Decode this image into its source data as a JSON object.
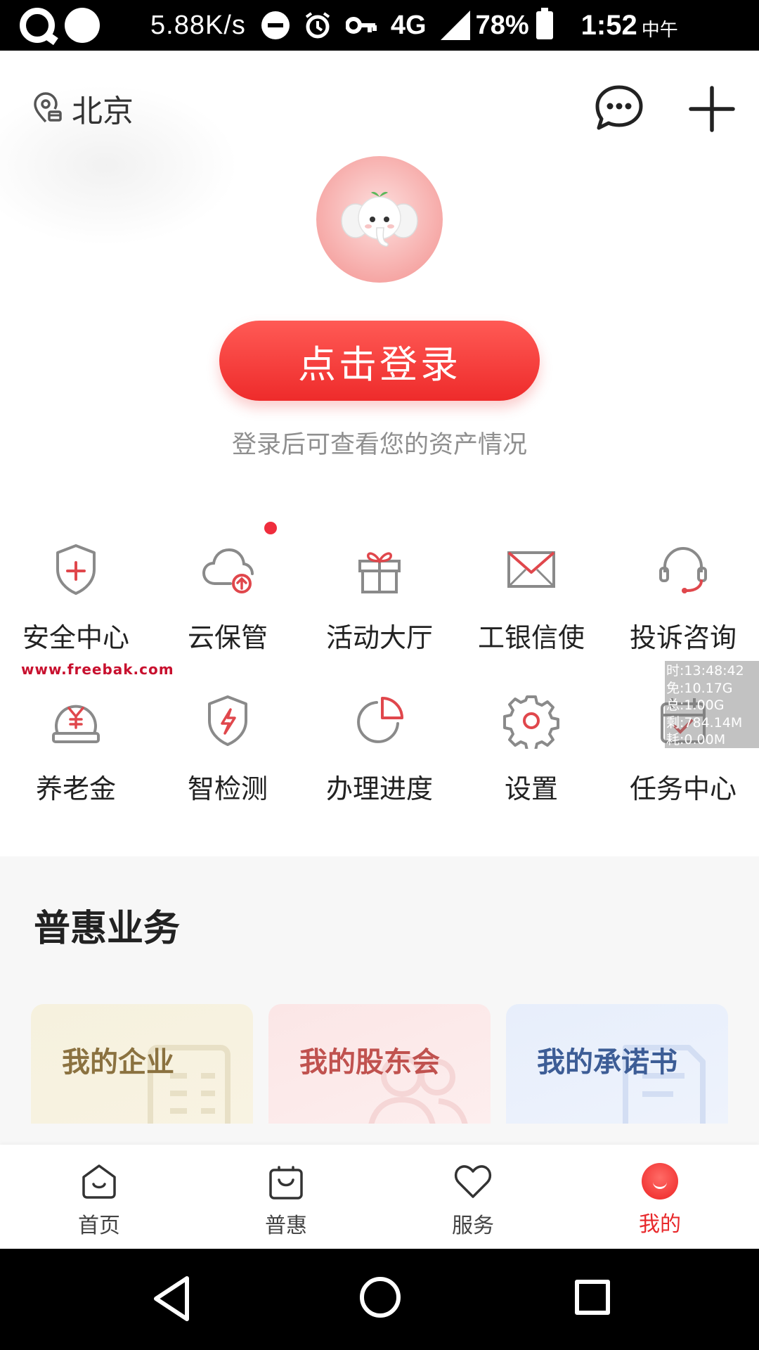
{
  "status_bar": {
    "speed": "5.88K/s",
    "network": "4G",
    "battery": "78%",
    "time": "1:52",
    "ampm": "中午"
  },
  "header": {
    "location": "北京"
  },
  "login": {
    "button": "点击登录",
    "hint": "登录后可查看您的资产情况"
  },
  "grid": {
    "items": [
      {
        "label": "安全中心",
        "icon": "shield-plus-icon"
      },
      {
        "label": "云保管",
        "icon": "cloud-upload-icon"
      },
      {
        "label": "活动大厅",
        "icon": "gift-icon"
      },
      {
        "label": "工银信使",
        "icon": "envelope-icon"
      },
      {
        "label": "投诉咨询",
        "icon": "headset-icon"
      },
      {
        "label": "养老金",
        "icon": "yuan-coin-icon"
      },
      {
        "label": "智检测",
        "icon": "shield-lightning-icon"
      },
      {
        "label": "办理进度",
        "icon": "pie-progress-icon"
      },
      {
        "label": "设置",
        "icon": "gear-icon"
      },
      {
        "label": "任务中心",
        "icon": "calendar-task-icon"
      }
    ]
  },
  "watermark": "www.freebak.com",
  "overlay_stats": [
    "时:13:48:42",
    "免:10.17G",
    "总:1.00G",
    "剩:784.14M",
    "耗:0.00M"
  ],
  "section": {
    "title": "普惠业务",
    "cards": [
      {
        "label": "我的企业"
      },
      {
        "label": "我的股东会"
      },
      {
        "label": "我的承诺书"
      }
    ]
  },
  "tabs": [
    {
      "label": "首页",
      "icon": "home-icon"
    },
    {
      "label": "普惠",
      "icon": "bag-icon"
    },
    {
      "label": "服务",
      "icon": "heart-icon"
    },
    {
      "label": "我的",
      "icon": "me-icon",
      "active": true
    }
  ],
  "colors": {
    "accent": "#ee2b2b",
    "icon_red": "#e0474c",
    "icon_gray": "#8a8a8a"
  }
}
